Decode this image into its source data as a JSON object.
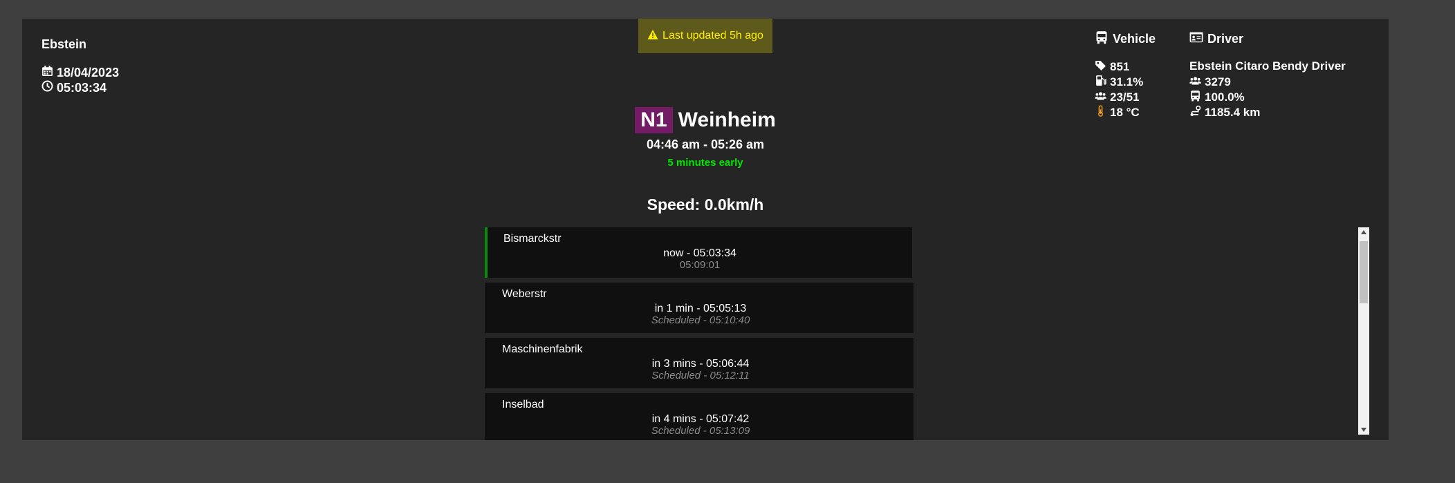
{
  "company": "Ebstein",
  "date": "18/04/2023",
  "time": "05:03:34",
  "warning": "Last updated 5h ago",
  "route": {
    "line": "N1",
    "destination": "Weinheim",
    "times": "04:46 am - 05:26 am",
    "status": "5 minutes early"
  },
  "speed": "Speed: 0.0km/h",
  "stops": [
    {
      "name": "Bismarckstr",
      "eta": "now - 05:03:34",
      "scheduled": "05:09:01"
    },
    {
      "name": "Weberstr",
      "eta": "in 1 min - 05:05:13",
      "scheduled": "Scheduled - 05:10:40"
    },
    {
      "name": "Maschinenfabrik",
      "eta": "in 3 mins - 05:06:44",
      "scheduled": "Scheduled - 05:12:11"
    },
    {
      "name": "Inselbad",
      "eta": "in 4 mins - 05:07:42",
      "scheduled": "Scheduled - 05:13:09"
    }
  ],
  "vehicle": {
    "title": "Vehicle",
    "number": "851",
    "fuel": "31.1%",
    "passengers": "23/51",
    "temperature": "18 °C"
  },
  "driver": {
    "title": "Driver",
    "name": "Ebstein Citaro Bendy Driver",
    "id": "3279",
    "rating": "100.0%",
    "distance": "1185.4 km"
  },
  "colors": {
    "line_badge": "#731b64",
    "early": "#00e600",
    "warning_bg": "#5e5a1b",
    "warning_text": "#ffee00",
    "current_stop": "#0a8a0a"
  },
  "icons": {
    "date": "calendar-icon",
    "time": "clock-icon",
    "warning": "warning-triangle-icon",
    "vehicle": "bus-icon",
    "driver": "id-card-icon",
    "number": "tag-icon",
    "fuel": "fuel-pump-icon",
    "passengers": "users-icon",
    "temperature": "thermometer-icon",
    "driver_id": "users-icon",
    "rating": "bus-icon",
    "distance": "route-icon"
  }
}
